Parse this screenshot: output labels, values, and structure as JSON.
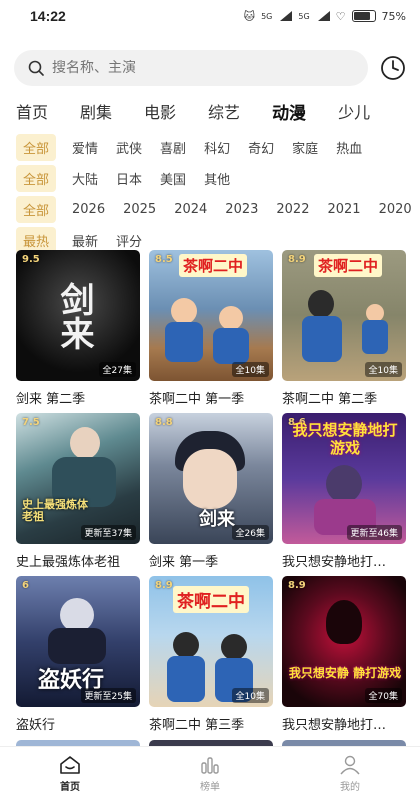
{
  "status": {
    "time": "14:22",
    "net1": "5G",
    "net2": "5G",
    "battery": "75%"
  },
  "search": {
    "placeholder": "搜名称、主演"
  },
  "tabs": [
    "首页",
    "剧集",
    "电影",
    "综艺",
    "动漫",
    "少儿"
  ],
  "active_tab": "动漫",
  "filters": {
    "genre": [
      "全部",
      "爱情",
      "武侠",
      "喜剧",
      "科幻",
      "奇幻",
      "家庭",
      "热血"
    ],
    "region": [
      "全部",
      "大陆",
      "日本",
      "美国",
      "其他"
    ],
    "year": [
      "全部",
      "2026",
      "2025",
      "2024",
      "2023",
      "2022",
      "2021",
      "2020"
    ],
    "sort": [
      "最热",
      "最新",
      "评分"
    ]
  },
  "cards": [
    {
      "title": "剑来 第二季",
      "rating": "9.5",
      "episodes": "全27集",
      "poster_text": "剑来",
      "bg": "#1c1c1c"
    },
    {
      "title": "茶啊二中 第一季",
      "rating": "8.5",
      "episodes": "全10集",
      "poster_text": "茶啊二中",
      "bg": "#5a7fa6"
    },
    {
      "title": "茶啊二中 第二季",
      "rating": "8.9",
      "episodes": "全10集",
      "poster_text": "茶啊二中",
      "bg": "#8c8a66"
    },
    {
      "title": "史上最强炼体老祖",
      "rating": "7.5",
      "episodes": "更新至37集",
      "poster_text": "史上最强炼体老祖",
      "bg": "#3a5560"
    },
    {
      "title": "剑来 第一季",
      "rating": "8.8",
      "episodes": "全26集",
      "poster_text": "剑来",
      "bg": "#4d5b73"
    },
    {
      "title": "我只想安静地打…",
      "rating": "8.6",
      "episodes": "更新至46集",
      "poster_text": "我只想安静地打游戏",
      "bg": "#3b2f6b"
    },
    {
      "title": "盗妖行",
      "rating": "6",
      "episodes": "更新至25集",
      "poster_text": "盗妖行",
      "bg": "#1f2a4d"
    },
    {
      "title": "茶啊二中 第三季",
      "rating": "8.9",
      "episodes": "全10集",
      "poster_text": "茶啊二中",
      "bg": "#6fa2c9"
    },
    {
      "title": "我只想安静地打…",
      "rating": "8.9",
      "episodes": "全70集",
      "poster_text": "我只想安静 静打游戏",
      "bg": "#2a0d1a"
    }
  ],
  "bottom_nav": [
    {
      "label": "首页",
      "icon": "home-icon",
      "active": true
    },
    {
      "label": "榜单",
      "icon": "chart-icon",
      "active": false
    },
    {
      "label": "我的",
      "icon": "user-icon",
      "active": false
    }
  ],
  "colors": {
    "accent": "#c8953a",
    "chip_bg": "#fbf0cf",
    "rating": "#f3d37a"
  }
}
